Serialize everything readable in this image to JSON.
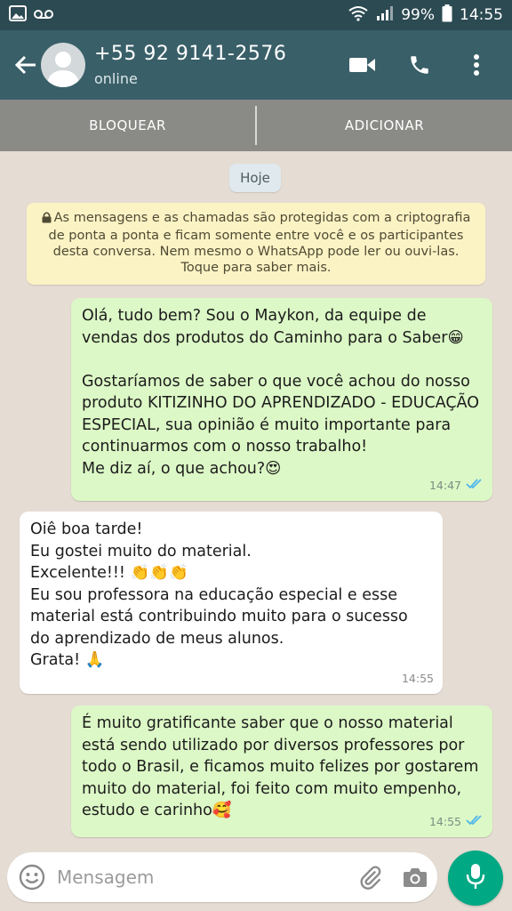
{
  "status_bar": {
    "left_icons": [
      "gallery-icon",
      "voicemail-icon"
    ],
    "battery": "99%",
    "time": "14:55"
  },
  "header": {
    "contact_name": "+55 92 9141-2576",
    "contact_status": "online",
    "actions": [
      "video-call-icon",
      "phone-icon",
      "more-icon"
    ]
  },
  "action_bar": {
    "block_label": "BLOQUEAR",
    "add_label": "ADICIONAR"
  },
  "chat": {
    "date_label": "Hoje",
    "encryption_notice": "As mensagens e as chamadas são protegidas com a criptografia de ponta a ponta e ficam somente entre você e os participantes desta conversa. Nem mesmo o WhatsApp pode ler ou ouvi-las. Toque para saber mais.",
    "messages": [
      {
        "direction": "outgoing",
        "text": "Olá, tudo bem? Sou o Maykon, da equipe de vendas dos produtos do Caminho para o Saber😁\n\nGostaríamos de saber o que você achou do nosso produto KITIZINHO DO APRENDIZADO - EDUCAÇÃO ESPECIAL, sua opinião é muito importante para continuarmos com o nosso trabalho!\nMe diz aí, o que achou?😍",
        "time": "14:47",
        "status": "read"
      },
      {
        "direction": "incoming",
        "text": "Oiê boa tarde!\nEu gostei muito do material.\nExcelente!!! 👏👏👏\nEu sou professora na educação especial e esse material está contribuindo muito para o sucesso do aprendizado de meus alunos.\nGrata! 🙏",
        "time": "14:55"
      },
      {
        "direction": "outgoing",
        "text": "É muito gratificante saber que o nosso material está sendo utilizado por diversos professores por todo o Brasil, e ficamos muito felizes por gostarem muito do material, foi feito com muito empenho, estudo e carinho🥰",
        "time": "14:55",
        "status": "read"
      }
    ]
  },
  "input_bar": {
    "placeholder": "Mensagem",
    "value": ""
  },
  "colors": {
    "header": "#395f68",
    "status_bar": "#2c4a52",
    "outgoing_bubble": "#dcf8c6",
    "incoming_bubble": "#ffffff",
    "read_ticks": "#4fb6ec",
    "mic_button": "#00a884"
  }
}
